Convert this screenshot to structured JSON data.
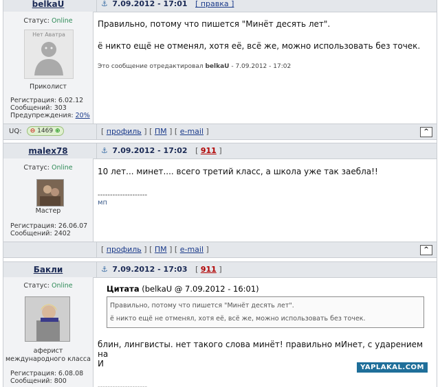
{
  "posts": [
    {
      "author": "belkaU",
      "date": "7.09.2012 - 17:01",
      "header_link": "[ правка ]",
      "status_label": "Статус:",
      "status_value": "Online",
      "avatar_text": "Нет Аватра",
      "rank": "Приколист",
      "reg": "Регистрация: 6.02.12",
      "messages": "Сообщений: 303",
      "warnings_label": "Предупреждения:",
      "warnings_value": "20%",
      "line1": "Правильно, потому что пишется \"Минёт десять лет\".",
      "line2": "ё никто ещё не отменял, хотя её, всё же, можно использовать без точек.",
      "edit_prefix": "Это сообщение отредактировал",
      "edit_author": "belkaU",
      "edit_suffix": "- 7.09.2012 - 17:02",
      "uq_label": "UQ:",
      "uq_value": "1469"
    },
    {
      "author": "malex78",
      "date": "7.09.2012 - 17:02",
      "header_link": "911",
      "status_label": "Статус:",
      "status_value": "Online",
      "rank": "Мастер",
      "reg": "Регистрация: 26.06.07",
      "messages": "Сообщений: 2402",
      "line1": "10 лет... минет.... всего третий класс, а школа уже так заебла!!",
      "sig_line": "--------------------",
      "sig": "мп"
    },
    {
      "author": "Бакли",
      "date": "7.09.2012 - 17:03",
      "header_link": "911",
      "status_label": "Статус:",
      "status_value": "Online",
      "rank_line1": "аферист",
      "rank_line2": "международного класса",
      "reg": "Регистрация: 6.08.08",
      "messages": "Сообщений: 800",
      "quote_label": "Цитата",
      "quote_source": "(belkaU @ 7.09.2012 - 16:01)",
      "quote_line1": "Правильно, потому что пишется \"Минёт десять лет\".",
      "quote_line2": "ё никто ещё не отменял, хотя её, всё же, можно использовать без точек.",
      "line1": "блин, лингвисты. нет такого слова минёт! правильно мИнет, с ударением на",
      "line2": "И",
      "sig_line": "--------------------"
    }
  ],
  "footer": {
    "profile": "профиль",
    "pm": "ПМ",
    "email": "e-mail",
    "up": "^"
  },
  "watermark": "YAPLAKAL.COM"
}
